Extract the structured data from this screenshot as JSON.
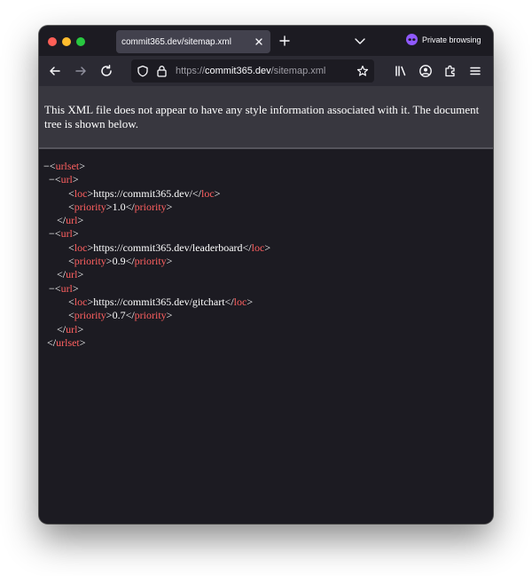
{
  "browser": {
    "tab_title": "commit365.dev/sitemap.xml",
    "private_label": "Private browsing",
    "url_prefix": "https://",
    "url_host": "commit365.dev",
    "url_path": "/sitemap.xml"
  },
  "info_bar": {
    "message": "This XML file does not appear to have any style information associated with it. The document tree is shown below."
  },
  "xml": {
    "collapse_glyph": "−",
    "root_tag": "urlset",
    "url_tag": "url",
    "loc_tag": "loc",
    "priority_tag": "priority",
    "entries": [
      {
        "loc": "https://commit365.dev/",
        "priority": "1.0"
      },
      {
        "loc": "https://commit365.dev/leaderboard",
        "priority": "0.9"
      },
      {
        "loc": "https://commit365.dev/gitchart",
        "priority": "0.7"
      }
    ]
  },
  "colors": {
    "tag": "#ff6060",
    "background": "#1c1b22",
    "toolbar": "#2b2a33",
    "info_bar": "#38373f"
  },
  "icons": [
    "back-arrow-icon",
    "forward-arrow-icon",
    "reload-icon",
    "shield-icon",
    "lock-icon",
    "star-icon",
    "library-icon",
    "account-icon",
    "extensions-icon",
    "menu-icon",
    "close-icon",
    "plus-icon",
    "chevron-down-icon",
    "private-mask-icon"
  ]
}
